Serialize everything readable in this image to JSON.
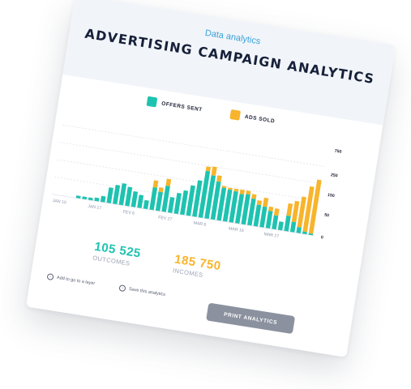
{
  "header": {
    "subtitle": "Data analytics",
    "title": "ADVERTISING CAMPAIGN ANALYTICS"
  },
  "legend": [
    {
      "label": "OFFERS SENT",
      "color": "#1ec3b0"
    },
    {
      "label": "ADS SOLD",
      "color": "#f7b42c"
    }
  ],
  "chart_data": {
    "type": "bar",
    "x_ticks": [
      "JAN 10",
      "JAN 17",
      "FEV 6",
      "FEV 27",
      "MAR 6",
      "MAR 16",
      "MAR 27"
    ],
    "y_ticks": [
      "750",
      "250",
      "150",
      "50",
      "0"
    ],
    "series": [
      {
        "name": "OFFERS SENT",
        "color": "#1ec3b0",
        "values": [
          3,
          3,
          3,
          4,
          7,
          18,
          22,
          25,
          22,
          18,
          15,
          10,
          26,
          22,
          30,
          18,
          24,
          28,
          35,
          42,
          54,
          50,
          44,
          38,
          37,
          36,
          34,
          35,
          31,
          25,
          24,
          20,
          16,
          10,
          18,
          12,
          7,
          3,
          2
        ]
      },
      {
        "name": "ADS SOLD",
        "color": "#f7b42c",
        "values": [
          0,
          0,
          0,
          0,
          0,
          0,
          0,
          0,
          0,
          0,
          0,
          0,
          8,
          5,
          8,
          0,
          0,
          0,
          0,
          0,
          5,
          10,
          7,
          2,
          2,
          3,
          5,
          4,
          5,
          5,
          10,
          5,
          8,
          0,
          14,
          24,
          35,
          52,
          62
        ]
      }
    ]
  },
  "stats": {
    "outcomes_value": "105 525",
    "outcomes_label": "OUTCOMES",
    "incomes_value": "185 750",
    "incomes_label": "INCOMES"
  },
  "links": {
    "pipe_label": "Add to go to a layer",
    "save_label": "Save this analytics"
  },
  "button": {
    "print_label": "PRINT ANALYTICS"
  },
  "colors": {
    "teal": "#1ec3b0",
    "yellow": "#f7b42c",
    "title": "#17203a",
    "accent_blue": "#3aa0d8"
  }
}
